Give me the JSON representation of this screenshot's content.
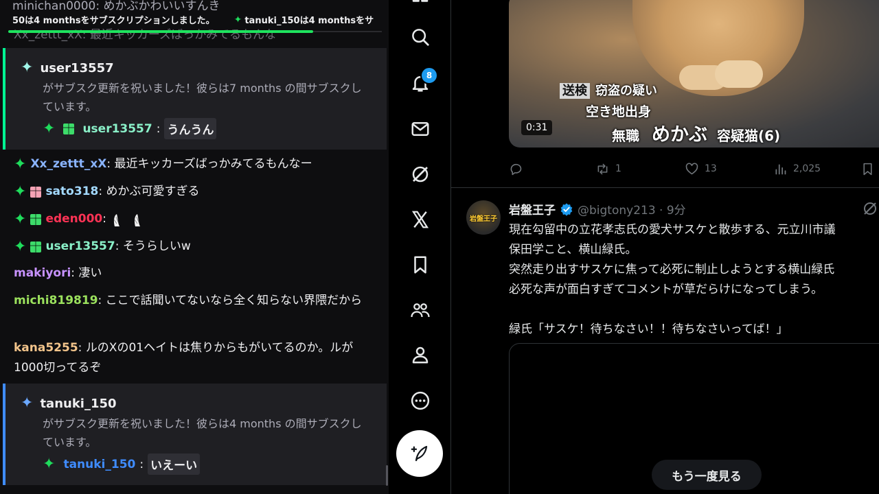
{
  "chat": {
    "ticker_top": "minichan0000: めかぶかわいいすんき",
    "ticker_left": "50は4 monthsをサブスクリプションしました。",
    "ticker_right": "tanuki_150は4 monthsをサ",
    "ticker_under": "Xx_zettt_xX: 最近キッカーズばっかみてるもんな",
    "sub_card_1": {
      "user": "user13557",
      "desc": "がサブスク更新を祝いました！彼らは7 months の間サブスクしています。",
      "msg_user": "user13557",
      "msg_text": "うんうん",
      "accent": "#00f593"
    },
    "lines": [
      {
        "name": "Xx_zettt_xX",
        "name_color": "#8ab4ff",
        "text": "最近キッカーズばっかみてるもんなー",
        "badges": [
          "gem"
        ]
      },
      {
        "name": "sato318",
        "name_color": "#a3d9ff",
        "text": "めかぶ可愛すぎる",
        "badges": [
          "gem",
          "gift-pink"
        ]
      },
      {
        "name": "eden000",
        "name_color": "#ff3355",
        "text": "",
        "badges": [
          "gem",
          "gift-green"
        ]
      },
      {
        "name": "user13557",
        "name_color": "#8af0c8",
        "text": "そうらしいw",
        "badges": [
          "gem",
          "gift-green"
        ]
      },
      {
        "name": "makiyori",
        "name_color": "#c792ff",
        "text": "凄い",
        "badges": []
      },
      {
        "name": "michi819819",
        "name_color": "#9be15d",
        "text": "ここで話聞いてないなら全く知らない界隈だから",
        "badges": []
      },
      {
        "name": "kana5255",
        "name_color": "#f2c48b",
        "text": "ルのXの01ヘイトは焦りからもがいてるのか。ルが1000切ってるぞ",
        "badges": []
      }
    ],
    "sub_card_2": {
      "user": "tanuki_150",
      "desc": "がサブスク更新を祝いました！彼らは4 months の間サブスクしています。",
      "msg_user": "tanuki_150",
      "msg_text": "いえーい",
      "accent": "#3f8cff"
    }
  },
  "nav": {
    "notification_count": "8",
    "icons": [
      "grid-icon",
      "search-icon",
      "bell-icon",
      "mail-icon",
      "grok-icon",
      "x-logo-icon",
      "bookmark-icon",
      "communities-icon",
      "profile-icon",
      "more-icon",
      "compose-icon"
    ]
  },
  "timeline": {
    "video_top": {
      "tag": "送検",
      "line1": "窃盗の疑い",
      "line2": "空き地出身",
      "line3_a": "無職",
      "line3_b": "めかぶ",
      "line3_c": "容疑猫(6)",
      "duration": "0:31"
    },
    "actions": {
      "retweets": "1",
      "likes": "13",
      "views": "2,025"
    },
    "tweet": {
      "avatar_text": "岩盤王子",
      "display_name": "岩盤王子",
      "handle_time": "@bigtony213 · 9分",
      "body": "現在勾留中の立花孝志氏の愛犬サスケと散歩する、元立川市議\n保田学こと、横山緑氏。\n突然走り出すサスケに焦って必死に制止しようとする横山緑氏\n必死な声が面白すぎてコメントが草だらけになってしまう。\n\n緑氏「サスケ！待ちなさい！！待ちなさいってば！」",
      "replay_label": "もう一度見る"
    }
  }
}
